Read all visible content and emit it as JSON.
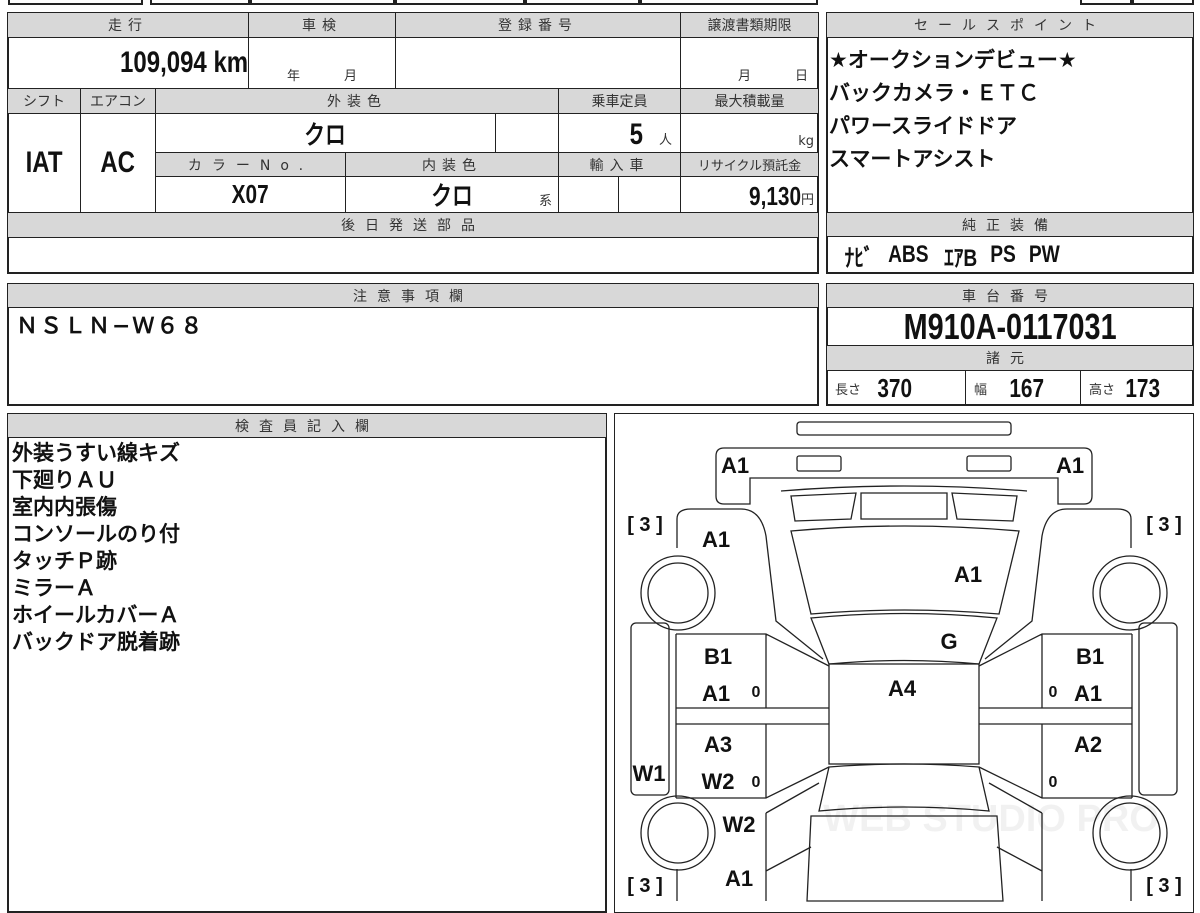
{
  "vehicle_table": {
    "mileage_label": "走行",
    "mileage_value": "109,094 km",
    "inspection_label": "車検",
    "inspection_year": "年",
    "inspection_month": "月",
    "registration_label": "登録番号",
    "registration_value": "",
    "transfer_deadline_label": "譲渡書類期限",
    "transfer_month": "月",
    "transfer_day": "日",
    "shift_label": "シフト",
    "shift_value": "IAT",
    "aircon_label": "エアコン",
    "aircon_value": "AC",
    "exterior_color_label": "外装色",
    "exterior_color_value": "クロ",
    "capacity_label": "乗車定員",
    "capacity_value": "5",
    "capacity_unit": "人",
    "max_load_label": "最大積載量",
    "max_load_unit": "kg",
    "color_no_label": "カラーNo.",
    "color_no_value": "X07",
    "interior_color_label": "内装色",
    "interior_color_value": "クロ",
    "interior_color_suffix": "系",
    "import_label": "輸入車",
    "recycle_label": "リサイクル預託金",
    "recycle_value": "9,130",
    "recycle_unit": "円",
    "later_parts_label": "後日発送部品"
  },
  "sales_points": {
    "label": "セールスポイント",
    "items": [
      "★オークションデビュー★",
      "バックカメラ・ＥＴＣ",
      "パワースライドドア",
      "スマートアシスト"
    ]
  },
  "equipment": {
    "label": "純正装備",
    "items": [
      "ﾅﾋﾞ",
      "ABS",
      "ｴｱB",
      "PS",
      "PW"
    ]
  },
  "notes": {
    "label": "注意事項欄",
    "text": "ＮＳＬＮ−Ｗ６８"
  },
  "chassis": {
    "label": "車台番号",
    "value": "M910A-0117031",
    "specs_label": "諸元",
    "length_label": "長さ",
    "length_value": "370",
    "width_label": "幅",
    "width_value": "167",
    "height_label": "高さ",
    "height_value": "173"
  },
  "inspector": {
    "label": "検査員記入欄",
    "items": [
      "外装うすい線キズ",
      "下廻りＡＵ",
      "室内内張傷",
      "コンソールのり付",
      "タッチＰ跡",
      "ミラーＡ",
      "ホイールカバーＡ",
      "バックドア脱着跡"
    ]
  },
  "diagram": {
    "marks": {
      "rear_left": "A1",
      "rear_right": "A1",
      "tire_rl": "[ 3 ]",
      "tire_rr": "[ 3 ]",
      "tire_fl": "[ 3 ]",
      "tire_fr": "[ 3 ]",
      "quarter_left": "A1",
      "back_door": "A1",
      "rear_glass": "G",
      "roof": "A4",
      "slide_door_left_1": "B1",
      "slide_door_left_2": "A1",
      "slide_door_left_zero": "0",
      "slide_door_right_1": "B1",
      "slide_door_right_2": "A1",
      "slide_door_right_zero": "0",
      "front_door_left_1": "A3",
      "front_door_left_2": "W2",
      "front_door_left_zero": "0",
      "front_door_right": "A2",
      "front_door_right_zero": "0",
      "step_left": "W1",
      "fender_left": "W2",
      "front_left": "A1"
    },
    "watermark": "WEB STUDIO PRO"
  }
}
